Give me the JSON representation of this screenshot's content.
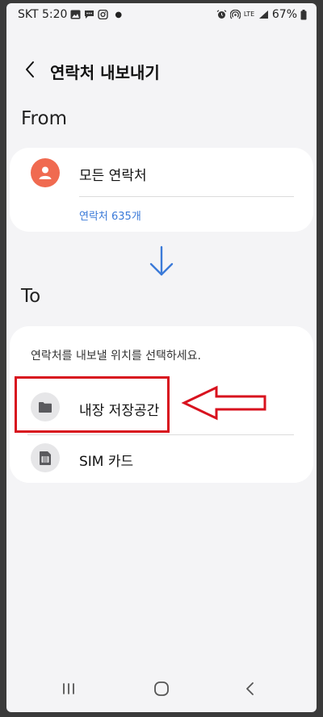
{
  "status_bar": {
    "carrier_time": "SKT 5:20",
    "network": "LTE",
    "battery": "67%"
  },
  "header": {
    "title": "연락처 내보내기"
  },
  "from": {
    "label": "From",
    "source_name": "모든 연락처",
    "count_text": "연락처 635개"
  },
  "to": {
    "label": "To",
    "hint": "연락처를 내보낼 위치를 선택하세요.",
    "options": [
      {
        "label": "내장 저장공간",
        "icon": "folder-icon"
      },
      {
        "label": "SIM 카드",
        "icon": "sim-card-icon"
      }
    ]
  },
  "colors": {
    "accent_blue": "#3b7ad8",
    "avatar_orange": "#f06a50",
    "highlight_red": "#d8121e"
  }
}
